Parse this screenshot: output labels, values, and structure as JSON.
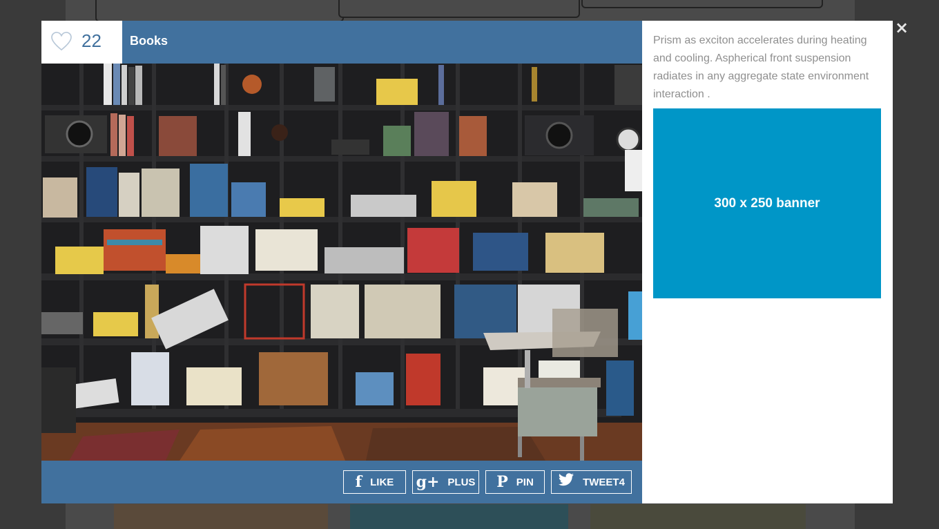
{
  "modal": {
    "likes": "22",
    "title": "Books",
    "description": "Prism as exciton accelerates during heating and cooling. Aspherical front suspension radiates in any aggregate state environment interaction .",
    "banner_label": "300 x 250 banner",
    "close_symbol": "×",
    "image_subject": "bookshelf-photo",
    "share_buttons": [
      {
        "icon": "f",
        "label": "LIKE",
        "icon_name": "facebook-icon"
      },
      {
        "icon": "g+",
        "label": "PLUS",
        "icon_name": "google-plus-icon"
      },
      {
        "icon": "P",
        "label": "PIN",
        "icon_name": "pinterest-icon"
      },
      {
        "icon": "🐦",
        "label": "TWEET4",
        "icon_name": "twitter-icon"
      }
    ]
  },
  "colors": {
    "header_blue": "#41719e",
    "banner_blue": "#0096c7",
    "overlay": "#3a3a3a"
  }
}
